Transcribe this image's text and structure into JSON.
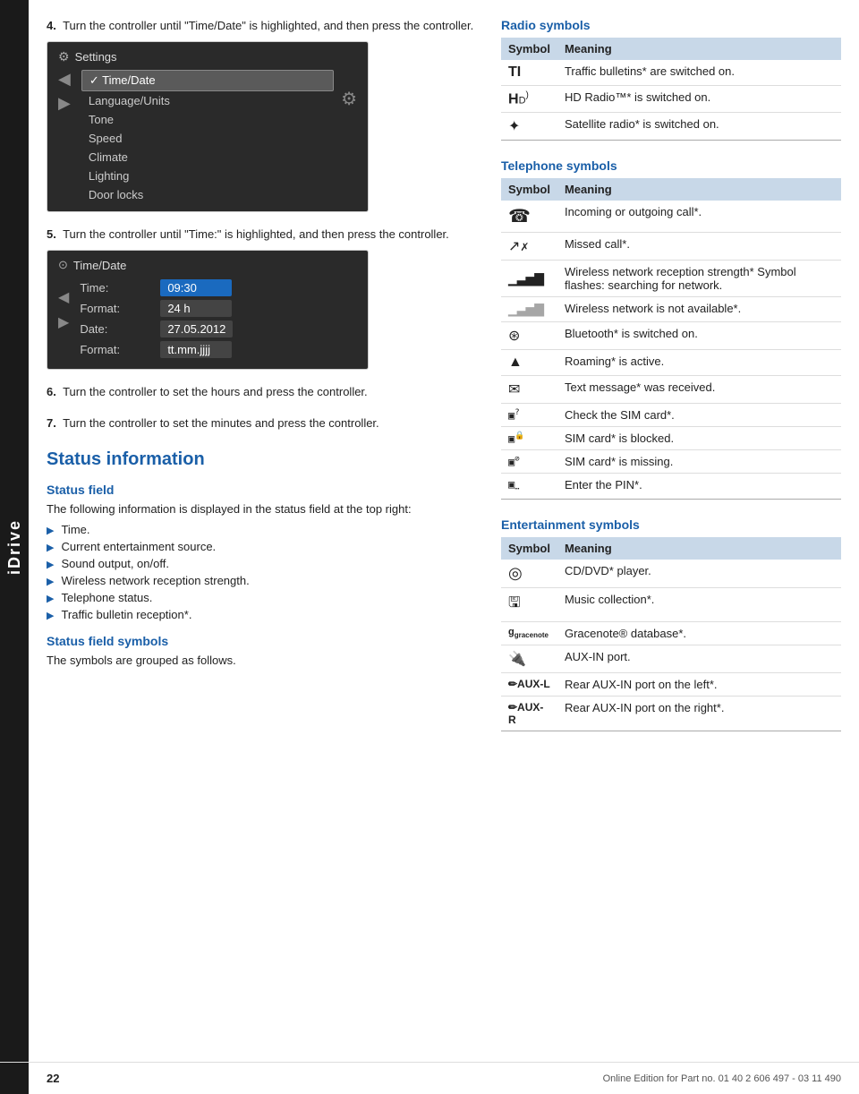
{
  "sidebar": {
    "label": "iDrive"
  },
  "steps": [
    {
      "number": "4.",
      "text": "Turn the controller until \"Time/Date\" is highlighted, and then press the controller."
    },
    {
      "number": "5.",
      "text": "Turn the controller until \"Time:\" is highlighted, and then press the controller."
    },
    {
      "number": "6.",
      "text": "Turn the controller to set the hours and press the controller."
    },
    {
      "number": "7.",
      "text": "Turn the controller to set the minutes and press the controller."
    }
  ],
  "screenshot1": {
    "title": "Settings",
    "items": [
      "Time/Date",
      "Language/Units",
      "Tone",
      "Speed",
      "Climate",
      "Lighting",
      "Door locks"
    ],
    "highlighted": "Time/Date"
  },
  "screenshot2": {
    "title": "Time/Date",
    "rows": [
      {
        "label": "Time:",
        "value": "09:30",
        "highlighted": false
      },
      {
        "label": "Format:",
        "value": "24 h",
        "highlighted": true
      },
      {
        "label": "Date:",
        "value": "27.05.2012",
        "highlighted": false
      },
      {
        "label": "Format:",
        "value": "tt.mm.jjjj",
        "highlighted": false
      }
    ]
  },
  "status_info": {
    "section_title": "Status information",
    "status_field": {
      "heading": "Status field",
      "description": "The following information is displayed in the status field at the top right:",
      "items": [
        "Time.",
        "Current entertainment source.",
        "Sound output, on/off.",
        "Wireless network reception strength.",
        "Telephone status.",
        "Traffic bulletin reception*."
      ]
    },
    "status_field_symbols": {
      "heading": "Status field symbols",
      "description": "The symbols are grouped as follows."
    }
  },
  "radio_symbols": {
    "title": "Radio symbols",
    "col_symbol": "Symbol",
    "col_meaning": "Meaning",
    "rows": [
      {
        "symbol": "TI",
        "meaning": "Traffic bulletins* are switched on."
      },
      {
        "symbol": "HD)",
        "meaning": "HD Radio™* is switched on."
      },
      {
        "symbol": "✦",
        "meaning": "Satellite radio* is switched on."
      }
    ]
  },
  "telephone_symbols": {
    "title": "Telephone symbols",
    "col_symbol": "Symbol",
    "col_meaning": "Meaning",
    "rows": [
      {
        "symbol": "📞",
        "meaning": "Incoming or outgoing call*."
      },
      {
        "symbol": "↗",
        "meaning": "Missed call*."
      },
      {
        "symbol": "▐▌▌▌",
        "meaning": "Wireless network reception strength* Symbol flashes: searching for network."
      },
      {
        "symbol": "░▌▌▌",
        "meaning": "Wireless network is not available*."
      },
      {
        "symbol": "⊛",
        "meaning": "Bluetooth* is switched on."
      },
      {
        "symbol": "▲",
        "meaning": "Roaming* is active."
      },
      {
        "symbol": "✉",
        "meaning": "Text message* was received."
      },
      {
        "symbol": "🖵?",
        "meaning": "Check the SIM card*."
      },
      {
        "symbol": "🖵🔒",
        "meaning": "SIM card* is blocked."
      },
      {
        "symbol": "🖵/",
        "meaning": "SIM card* is missing."
      },
      {
        "symbol": "🖵🔑",
        "meaning": "Enter the PIN*."
      }
    ]
  },
  "entertainment_symbols": {
    "title": "Entertainment symbols",
    "col_symbol": "Symbol",
    "col_meaning": "Meaning",
    "rows": [
      {
        "symbol": "◎",
        "meaning": "CD/DVD* player."
      },
      {
        "symbol": "🖨",
        "meaning": "Music collection*."
      },
      {
        "symbol": "g gracenote",
        "meaning": "Gracenote® database*."
      },
      {
        "symbol": "🔌",
        "meaning": "AUX-IN port."
      },
      {
        "symbol": "✏AUX-L",
        "meaning": "Rear AUX-IN port on the left*."
      },
      {
        "symbol": "✏AUX-R",
        "meaning": "Rear AUX-IN port on the right*."
      }
    ]
  },
  "footer": {
    "page": "22",
    "text": "Online Edition for Part no. 01 40 2 606 497 - 03 11 490"
  }
}
